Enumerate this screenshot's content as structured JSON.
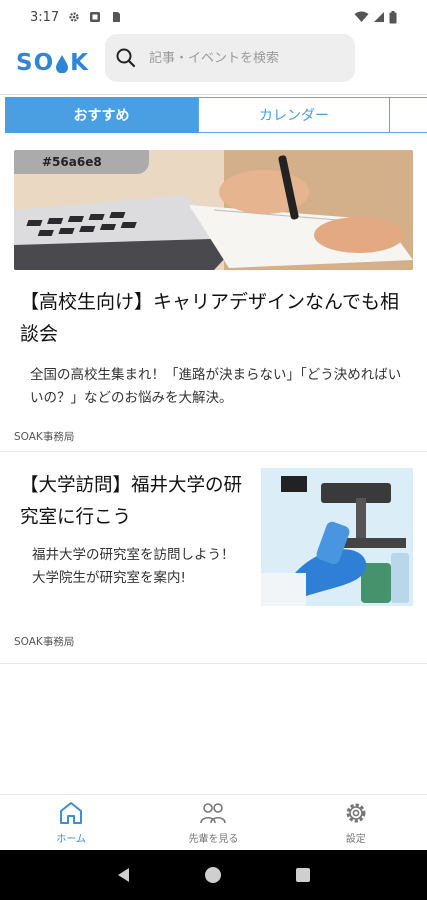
{
  "status_bar": {
    "time": "3:17"
  },
  "header": {
    "logo_text_left": "SO",
    "logo_text_right": "K",
    "search_placeholder": "記事・イベントを検索"
  },
  "tabs": [
    {
      "label": "おすすめ",
      "active": true
    },
    {
      "label": "カレンダー",
      "active": false
    }
  ],
  "articles": [
    {
      "badge": "#56a6e8",
      "title": "【高校生向け】キャリアデザインなんでも相談会",
      "description": "全国の高校生集まれ！「進路が決まらない」「どう決めればいいの？」などのお悩みを大解決。",
      "author": "SOAK事務局"
    },
    {
      "title": "【大学訪問】福井大学の研究室に行こう",
      "description": "福井大学の研究室を訪問しよう！\n大学院生が研究室を案内!",
      "author": "SOAK事務局"
    }
  ],
  "bottom_nav": [
    {
      "label": "ホーム",
      "icon": "home-icon",
      "active": true
    },
    {
      "label": "先輩を見る",
      "icon": "people-icon",
      "active": false
    },
    {
      "label": "設定",
      "icon": "gear-icon",
      "active": false
    }
  ],
  "colors": {
    "accent": "#4a9fe3",
    "badge_bg": "#ababab"
  }
}
